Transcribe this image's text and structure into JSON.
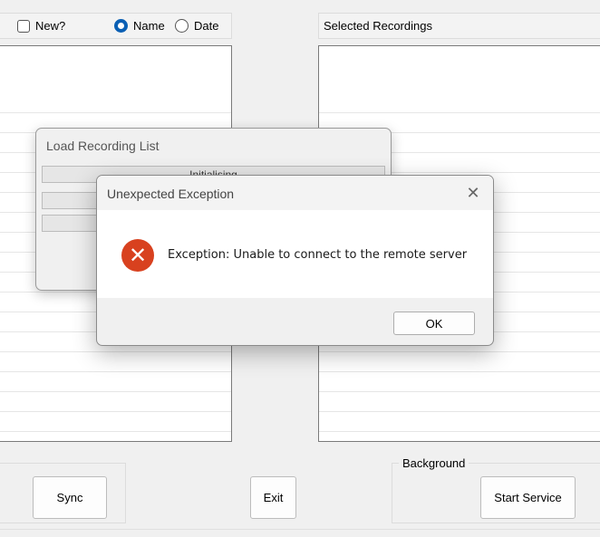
{
  "filter": {
    "new_label": "New?",
    "name_label": "Name",
    "date_label": "Date",
    "new_checked": false,
    "sort_selected": "Name"
  },
  "selected_panel": {
    "title": "Selected Recordings"
  },
  "buttons": {
    "sync": "Sync",
    "exit": "Exit",
    "start_service": "Start Service"
  },
  "background_group": {
    "label": "Background"
  },
  "load_dialog": {
    "title": "Load Recording List",
    "status": "Initialising"
  },
  "error_dialog": {
    "title": "Unexpected Exception",
    "close_glyph": "✕",
    "icon_glyph": "✕",
    "message": "Exception: Unable to connect to the remote server",
    "ok_label": "OK"
  },
  "colors": {
    "accent": "#0a5fb4",
    "error": "#d8411f",
    "background": "#f0f0f0"
  }
}
